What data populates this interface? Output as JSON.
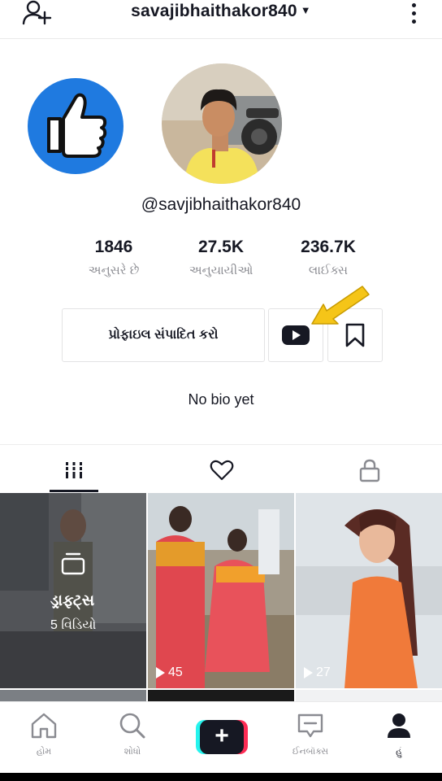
{
  "header": {
    "title": "savajibhaithakor840",
    "add_user_icon": "add-user-icon",
    "menu_icon": "more-vertical-icon"
  },
  "profile": {
    "handle": "@savjibhaithakor840",
    "like_badge_icon": "thumbs-up-icon",
    "stats": [
      {
        "value": "1846",
        "label": "અનુસરે છે"
      },
      {
        "value": "27.5K",
        "label": "અનુયાયીઓ"
      },
      {
        "value": "236.7K",
        "label": "લાઈક્સ"
      }
    ],
    "edit_button_label": "પ્રોફાઇલ સંપાદિત કરો",
    "bio": "No bio yet"
  },
  "tabs": [
    {
      "icon": "grid-icon",
      "active": true
    },
    {
      "icon": "heart-icon",
      "active": false
    },
    {
      "icon": "lock-icon",
      "active": false
    }
  ],
  "videos": {
    "drafts_title": "ડ્રાફ્ટ્સ",
    "drafts_count": "5 વિડિયો",
    "items": [
      {
        "views": "45"
      },
      {
        "views": "27"
      }
    ]
  },
  "navbar": {
    "home": "હોમ",
    "discover": "શોધો",
    "create": "+",
    "inbox": "ઈનબૉક્સ",
    "me": "હું"
  },
  "colors": {
    "accent_red": "#fe2c55",
    "accent_cyan": "#25f4ee",
    "facebook_blue": "#1f7ae0",
    "arrow_yellow": "#f5c518"
  }
}
